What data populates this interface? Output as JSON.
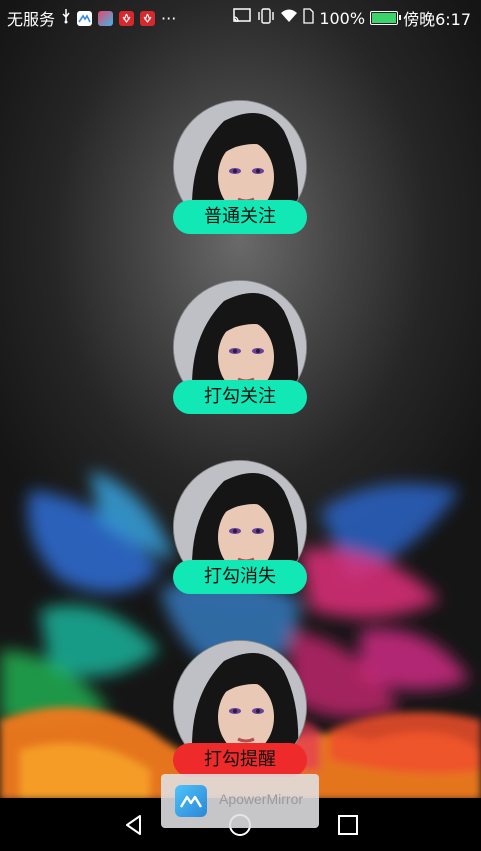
{
  "status_bar": {
    "carrier": "无服务",
    "more": "···",
    "battery_percent": "100%",
    "time": "傍晚6:17",
    "icons": [
      "usb-icon",
      "apowermirror-app-icon",
      "app-icon-2",
      "huawei-icon",
      "huawei-icon-2",
      "cast-icon",
      "vibrate-icon",
      "wifi-icon",
      "sim-icon",
      "battery-icon"
    ]
  },
  "items": [
    {
      "label": "普通关注",
      "button_color": "#11e8b6"
    },
    {
      "label": "打勾关注",
      "button_color": "#11e8b6"
    },
    {
      "label": "打勾消失",
      "button_color": "#11e8b6"
    },
    {
      "label": "打勾提醒",
      "button_color": "#ef2a2a"
    }
  ],
  "overlay": {
    "app_name": "ApowerMirror"
  },
  "nav_bar": {
    "icons": [
      "back-icon",
      "home-icon",
      "recents-icon"
    ]
  }
}
